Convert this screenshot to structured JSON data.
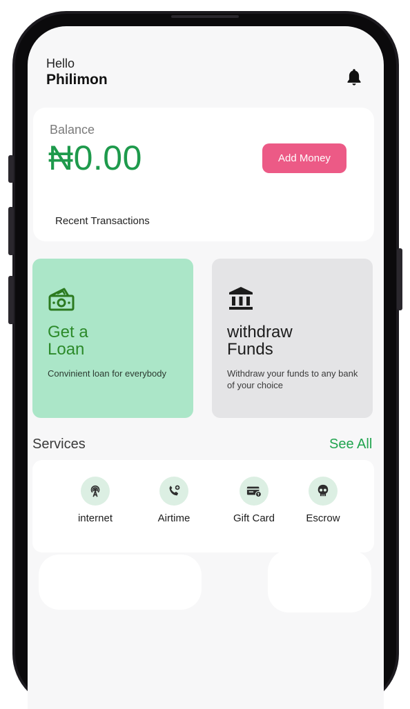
{
  "header": {
    "greeting": "Hello",
    "user_name": "Philimon"
  },
  "balance": {
    "label": "Balance",
    "amount": "₦0.00",
    "add_money_label": "Add Money",
    "recent_transactions_label": "Recent Transactions"
  },
  "tiles": [
    {
      "title": "Get a\nLoan",
      "description": "Convinient loan for everybody",
      "icon": "money-icon"
    },
    {
      "title": "withdraw\nFunds",
      "description": "Withdraw your funds to any bank of your choice",
      "icon": "bank-icon"
    }
  ],
  "services": {
    "label": "Services",
    "see_all_label": "See All",
    "items": [
      {
        "label": "internet",
        "icon": "internet-icon"
      },
      {
        "label": "Airtime",
        "icon": "phone-call-icon"
      },
      {
        "label": "Gift Card",
        "icon": "gift-card-icon"
      },
      {
        "label": "Escrow",
        "icon": "escrow-icon"
      }
    ]
  },
  "colors": {
    "accent_green": "#1e9a4c",
    "pink_button": "#ec5a86",
    "loan_tile": "#abe6c8",
    "withdraw_tile": "#e4e4e6"
  }
}
